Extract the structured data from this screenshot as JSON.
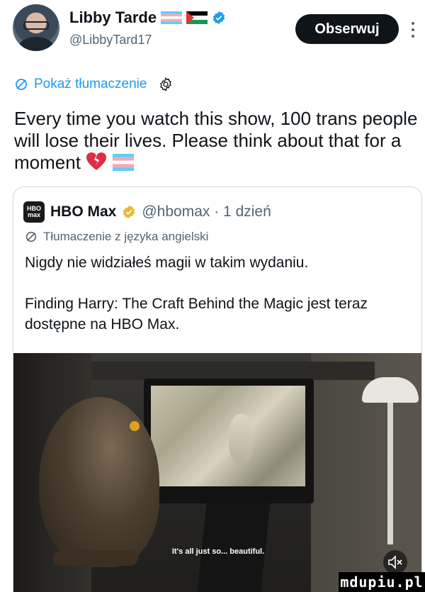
{
  "author": {
    "name": "Libby Tarde",
    "handle": "@LibbyTard17",
    "avatar_icon": "profile-avatar",
    "flag_icons": [
      "trans-pride-flag",
      "palestine-flag"
    ],
    "verified_icon": "verified-badge-icon"
  },
  "header": {
    "follow_label": "Obserwuj",
    "more_icon": "more-vertical-icon"
  },
  "translate": {
    "label": "Pokaż tłumaczenie",
    "icon": "translate-icon",
    "settings_icon": "gear-icon"
  },
  "tweet": {
    "text": "Every time you watch this show, 100 trans people will lose their lives. Please think about that for a moment",
    "emojis": [
      "broken-heart-emoji",
      "trans-flag-emoji"
    ]
  },
  "quote": {
    "logo": "HBO max",
    "name": "HBO Max",
    "verified_icon": "gold-verified-badge-icon",
    "handle_time": "@hbomax · 1 dzień",
    "translation_note": "Tłumaczenie z języka angielski",
    "paragraphs": [
      "Nigdy nie widziałeś magii w takim wydaniu.",
      "Finding Harry: The Craft Behind the Magic jest teraz dostępne na HBO Max."
    ],
    "video": {
      "caption": "It's all just so... beautiful.",
      "mute_icon": "speaker-muted-icon"
    }
  },
  "watermark": "mdupiu.pl",
  "colors": {
    "accent": "#1d9bf0",
    "text": "#0f1419",
    "secondary": "#536471",
    "button_bg": "#0f1419"
  }
}
